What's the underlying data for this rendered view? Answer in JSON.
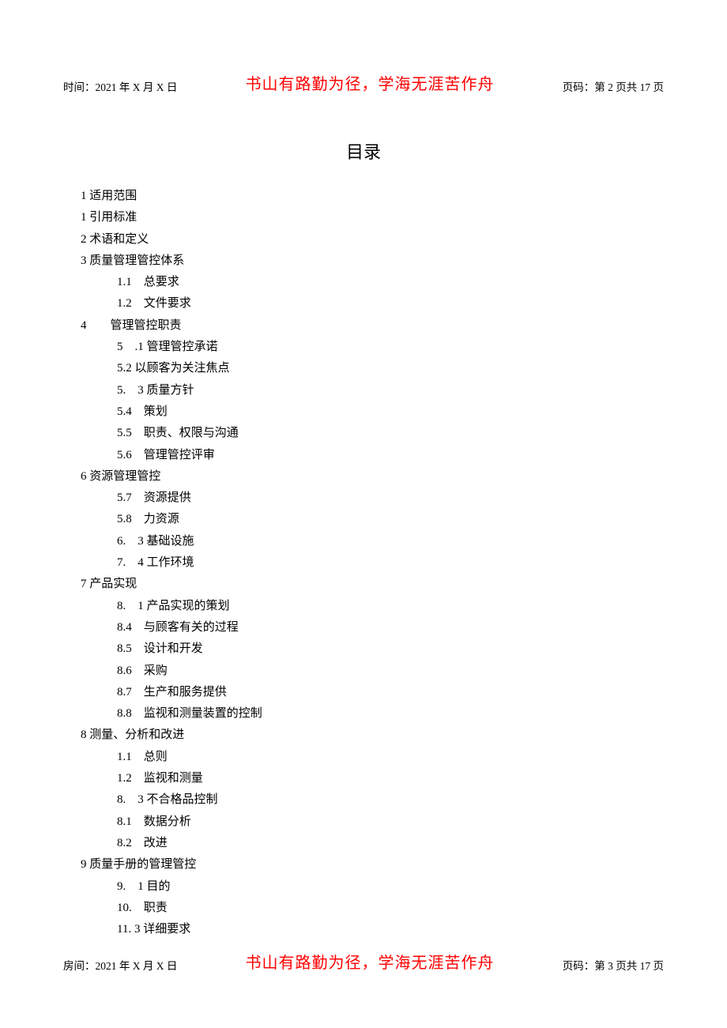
{
  "header": {
    "time_label": "时间：2021 年 X 月 X 日",
    "motto": "书山有路勤为径，学海无涯苦作舟",
    "page_label": "页码：第 2 页共 17 页"
  },
  "title": "目录",
  "toc": [
    {
      "level": 0,
      "text": "1 适用范围"
    },
    {
      "level": 0,
      "text": "1 引用标准"
    },
    {
      "level": 0,
      "text": "2 术语和定义"
    },
    {
      "level": 0,
      "text": "3 质量管理管控体系"
    },
    {
      "level": 1,
      "text": "1.1　总要求"
    },
    {
      "level": 1,
      "text": "1.2　文件要求"
    },
    {
      "level": 0,
      "text": "4　　管理管控职责"
    },
    {
      "level": 1,
      "text": "5　.1 管理管控承诺"
    },
    {
      "level": 1,
      "text": "5.2 以顾客为关注焦点"
    },
    {
      "level": 1,
      "text": "5.　3 质量方针"
    },
    {
      "level": 1,
      "text": "5.4　策划"
    },
    {
      "level": 1,
      "text": "5.5　职责、权限与沟通"
    },
    {
      "level": 1,
      "text": "5.6　管理管控评审"
    },
    {
      "level": 0,
      "text": "6 资源管理管控"
    },
    {
      "level": 1,
      "text": "5.7　资源提供"
    },
    {
      "level": 1,
      "text": "5.8　力资源"
    },
    {
      "level": 1,
      "text": "6.　3 基础设施"
    },
    {
      "level": 1,
      "text": "7.　4 工作环境"
    },
    {
      "level": 0,
      "text": "7 产品实现"
    },
    {
      "level": 1,
      "text": "8.　1 产品实现的策划"
    },
    {
      "level": 1,
      "text": "8.4　与顾客有关的过程"
    },
    {
      "level": 1,
      "text": "8.5　设计和开发"
    },
    {
      "level": 1,
      "text": "8.6　采购"
    },
    {
      "level": 1,
      "text": "8.7　生产和服务提供"
    },
    {
      "level": 1,
      "text": "8.8　监视和测量装置的控制"
    },
    {
      "level": 0,
      "text": "8 测量、分析和改进"
    },
    {
      "level": 1,
      "text": "1.1　总则"
    },
    {
      "level": 1,
      "text": "1.2　监视和测量"
    },
    {
      "level": 1,
      "text": "8.　3 不合格品控制"
    },
    {
      "level": 1,
      "text": "8.1　数据分析"
    },
    {
      "level": 1,
      "text": "8.2　改进"
    },
    {
      "level": 0,
      "text": "9 质量手册的管理管控"
    },
    {
      "level": 1,
      "text": "9.　1 目的"
    },
    {
      "level": 1,
      "text": "10.　职责"
    },
    {
      "level": 1,
      "text": "11. 3 详细要求"
    }
  ],
  "footer": {
    "time_label": "房间：2021 年 X 月 X 日",
    "motto": "书山有路勤为径，学海无涯苦作舟",
    "page_label": "页码：第 3 页共 17 页"
  }
}
